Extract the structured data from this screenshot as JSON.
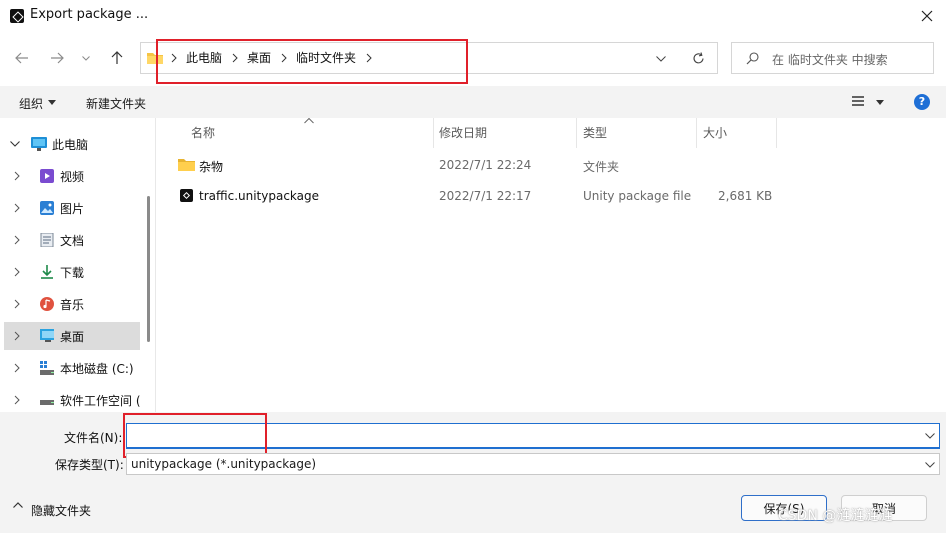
{
  "window": {
    "title": "Export package ..."
  },
  "address": {
    "breadcrumbs": [
      "此电脑",
      "桌面",
      "临时文件夹"
    ]
  },
  "search": {
    "placeholder": "在 临时文件夹 中搜索"
  },
  "toolbar": {
    "organize_label": "组织",
    "new_folder_label": "新建文件夹"
  },
  "sidebar": {
    "items": [
      {
        "label": "此电脑",
        "icon": "monitor-icon"
      },
      {
        "label": "视频",
        "icon": "video-icon"
      },
      {
        "label": "图片",
        "icon": "picture-icon"
      },
      {
        "label": "文档",
        "icon": "document-icon"
      },
      {
        "label": "下载",
        "icon": "download-icon"
      },
      {
        "label": "音乐",
        "icon": "music-icon"
      },
      {
        "label": "桌面",
        "icon": "desktop-icon"
      },
      {
        "label": "本地磁盘 (C:)",
        "icon": "disk-icon"
      },
      {
        "label": "软件工作空间 (",
        "icon": "drive-icon"
      }
    ]
  },
  "file_list": {
    "columns": [
      "名称",
      "修改日期",
      "类型",
      "大小"
    ],
    "rows": [
      {
        "name": "杂物",
        "modified": "2022/7/1 22:24",
        "type": "文件夹",
        "size": "",
        "icon": "folder-icon"
      },
      {
        "name": "traffic.unitypackage",
        "modified": "2022/7/1 22:17",
        "type": "Unity package file",
        "size": "2,681 KB",
        "icon": "unity-icon"
      }
    ]
  },
  "bottom": {
    "filename_label": "文件名(N):",
    "filename_value": "",
    "filetype_label": "保存类型(T):",
    "filetype_value": "unitypackage (*.unitypackage)",
    "hide_folders_label": "隐藏文件夹",
    "save_label": "保存(S)",
    "cancel_label": "取消"
  },
  "watermark": "CSDN @涟涟涟涟",
  "colors": {
    "accent": "#1f6fd0",
    "highlight_box": "#e0202a",
    "folder": "#f5c445"
  }
}
